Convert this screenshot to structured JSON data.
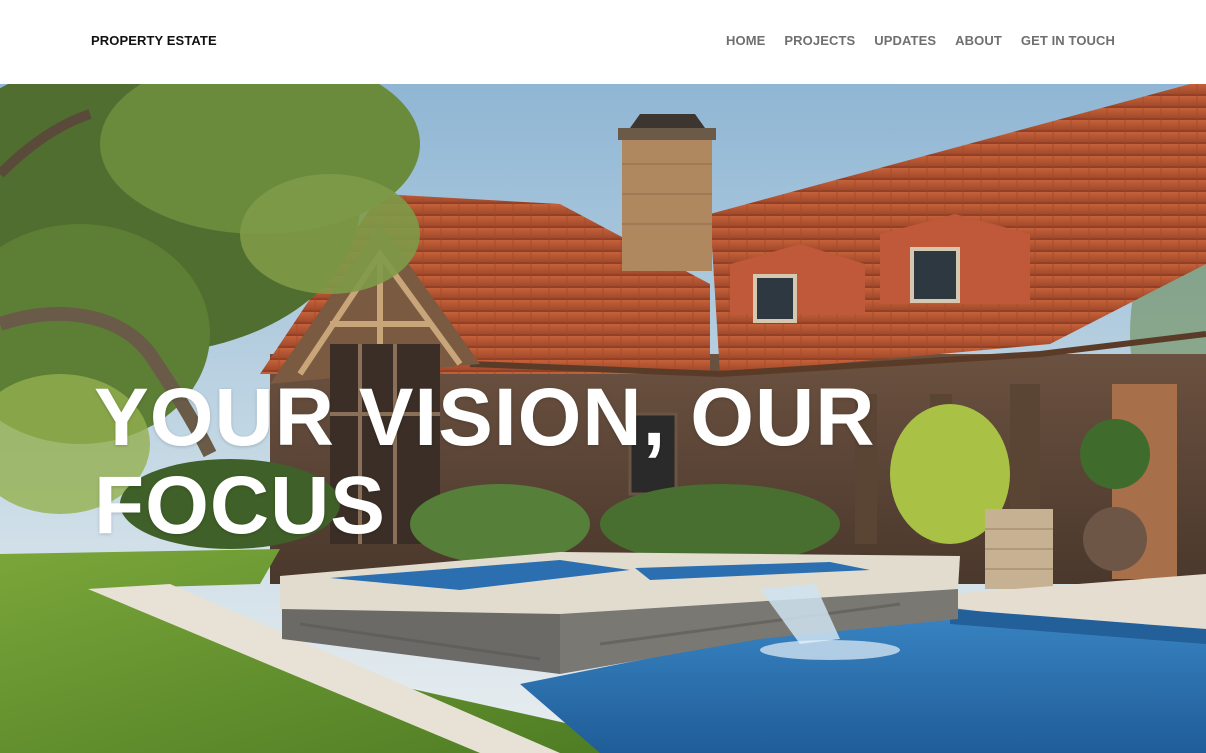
{
  "header": {
    "brand": "PROPERTY ESTATE",
    "nav": [
      {
        "label": "HOME"
      },
      {
        "label": "PROJECTS"
      },
      {
        "label": "UPDATES"
      },
      {
        "label": "ABOUT"
      },
      {
        "label": "GET IN TOUCH"
      }
    ]
  },
  "hero": {
    "headline_line1": "YOUR VISION, OUR",
    "headline_line2": "FOCUS",
    "image_subject": "house-with-pool-photo"
  },
  "colors": {
    "nav_text": "#6f6f6f",
    "brand_text": "#111111",
    "headline": "#ffffff",
    "roof": "#b5532f",
    "pool": "#2f74b5",
    "grass": "#5c8a2a"
  }
}
